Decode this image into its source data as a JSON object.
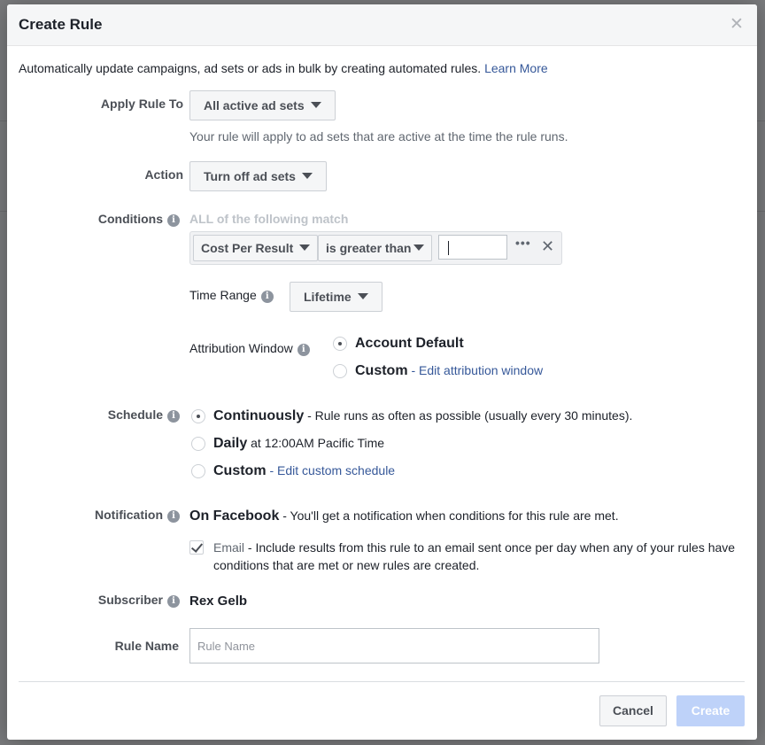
{
  "dialog": {
    "title": "Create Rule",
    "close_icon": "close-icon",
    "intro_text": "Automatically update campaigns, ad sets or ads in bulk by creating automated rules. ",
    "learn_more": "Learn More"
  },
  "apply_rule_to": {
    "label": "Apply Rule To",
    "value": "All active ad sets",
    "hint": "Your rule will apply to ad sets that are active at the time the rule runs."
  },
  "action": {
    "label": "Action",
    "value": "Turn off ad sets"
  },
  "conditions": {
    "label": "Conditions",
    "heading": "ALL of the following match",
    "metric": "Cost Per Result",
    "operator": "is greater than",
    "value": "",
    "more": "•••",
    "remove": "✕",
    "time_range_label": "Time Range",
    "time_range_value": "Lifetime",
    "attribution_label": "Attribution Window",
    "attribution_options": [
      {
        "label": "Account Default",
        "suffix": "",
        "link": "",
        "selected": true
      },
      {
        "label": "Custom",
        "suffix": " - ",
        "link": "Edit attribution window",
        "selected": false
      }
    ]
  },
  "schedule": {
    "label": "Schedule",
    "options": [
      {
        "label": "Continuously",
        "suffix": " - Rule runs as often as possible (usually every 30 minutes).",
        "link": "",
        "selected": true
      },
      {
        "label": "Daily",
        "suffix": " at 12:00AM Pacific Time",
        "link": "",
        "selected": false
      },
      {
        "label": "Custom",
        "suffix": " - ",
        "link": "Edit custom schedule",
        "selected": false
      }
    ]
  },
  "notification": {
    "label": "Notification",
    "on_facebook_bold": "On Facebook",
    "on_facebook_text": " - You'll get a notification when conditions for this rule are met.",
    "email_label": "Email",
    "email_text": " - Include results from this rule to an email sent once per day when any of your rules have conditions that are met or new rules are created.",
    "email_checked": true
  },
  "subscriber": {
    "label": "Subscriber",
    "name": "Rex Gelb"
  },
  "rule_name": {
    "label": "Rule Name",
    "placeholder": "Rule Name",
    "value": ""
  },
  "footer": {
    "cancel": "Cancel",
    "create": "Create"
  },
  "colors": {
    "link": "#365899",
    "create_disabled": "#bed2f9"
  }
}
